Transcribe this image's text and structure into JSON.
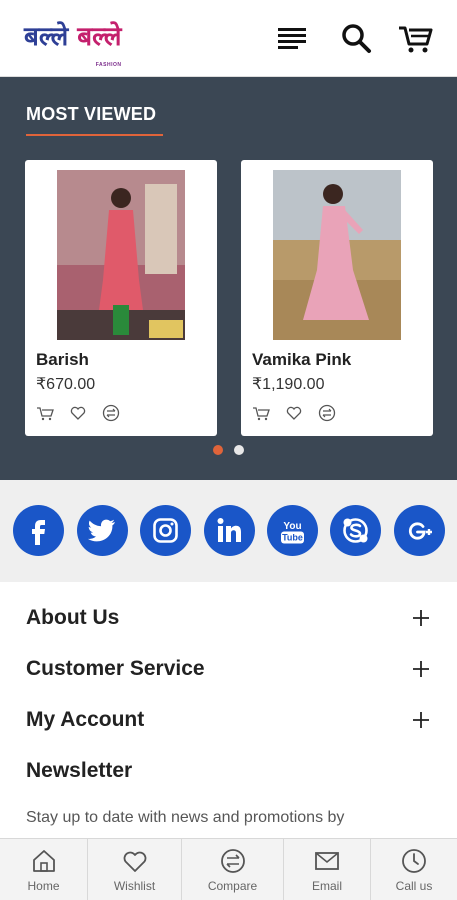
{
  "header": {
    "logo_word1": "बल्ले",
    "logo_word2": "बल्ले",
    "logo_tagline": "FASHION",
    "icons": [
      "menu-icon",
      "search-icon",
      "cart-icon"
    ]
  },
  "most_viewed": {
    "title": "MOST VIEWED",
    "products": [
      {
        "name": "Barish",
        "price": "₹670.00",
        "image": "pink-kurta-photo"
      },
      {
        "name": "Vamika Pink",
        "price": "₹1,190.00",
        "image": "pink-gown-photo"
      }
    ],
    "product_actions": [
      "cart-icon",
      "heart-icon",
      "compare-icon"
    ],
    "carousel": {
      "pages": 2,
      "active": 1
    }
  },
  "social": [
    "facebook",
    "twitter",
    "instagram",
    "linkedin",
    "youtube",
    "skype",
    "google-plus"
  ],
  "footer": {
    "sections": [
      "About Us",
      "Customer Service",
      "My Account"
    ],
    "newsletter_title": "Newsletter",
    "newsletter_text": "Stay up to date with news and promotions by"
  },
  "bottom_nav": [
    {
      "label": "Home",
      "icon": "home-icon"
    },
    {
      "label": "Wishlist",
      "icon": "heart-icon"
    },
    {
      "label": "Compare",
      "icon": "compare-icon"
    },
    {
      "label": "Email",
      "icon": "email-icon"
    },
    {
      "label": "Call us",
      "icon": "phone-icon"
    }
  ],
  "colors": {
    "header_bg": "#ffffff",
    "section_bg": "#3b4754",
    "accent": "#e0643a",
    "social_blue": "#1a56c8"
  }
}
